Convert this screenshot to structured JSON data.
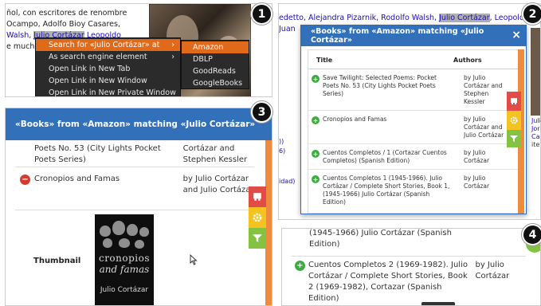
{
  "colors": {
    "popup_header": "#3270ba",
    "menu_highlight": "#e06a1a",
    "remove_icon": "#d63b30",
    "add_icon": "#3dab3d",
    "sidebar_red": "#e04c48",
    "sidebar_yellow": "#f2c321",
    "sidebar_green": "#84c341"
  },
  "step_labels": [
    "1",
    "2",
    "3",
    "4"
  ],
  "panel1": {
    "text_lines": [
      "ñol, con escritores de renombre",
      "Ocampo, Adolfo Bioy Casares,",
      "Walsh,",
      "Julio Cortázar",
      "Leopoldo",
      "e much"
    ],
    "context_menu": [
      {
        "label": "Search for «Julio Cortázar» at",
        "arrow": "›",
        "active": true
      },
      {
        "label": "As search engine element",
        "arrow": "›",
        "active": false
      },
      {
        "label": "Open Link in New Tab",
        "arrow": "",
        "active": false
      },
      {
        "label": "Open Link in New Window",
        "arrow": "",
        "active": false
      },
      {
        "label": "Open Link in New Private Window",
        "arrow": "",
        "active": false
      }
    ],
    "submenu": [
      {
        "label": "Amazon",
        "active": true
      },
      {
        "label": "DBLP",
        "active": false
      },
      {
        "label": "GoodReads",
        "active": false
      },
      {
        "label": "GoogleBooks",
        "active": false
      }
    ]
  },
  "panel2": {
    "bg_line1_prefix": "edetto, Alejandra Pizarnik, Rodolfo Walsh,",
    "bg_line1_highlight": "Julio Cortázar",
    "bg_line1_suffix": ", Leopoldo",
    "bg_line2": "Juan",
    "bg_small": [
      "))",
      "6)",
      "idad)"
    ],
    "right_text": [
      "Julio",
      "Jorg",
      "Cas",
      "ite"
    ],
    "popup_title": "«Books» from «Amazon» matching «Julio Cortázar»",
    "close_label": "×",
    "col_title": "Title",
    "col_authors": "Authors",
    "rows": [
      {
        "icon": "+",
        "title": "Save Twilight: Selected Poems: Pocket Poets No. 53 (City Lights Pocket Poets Series)",
        "authors": "by Julio Cortázar and Stephen Kessler"
      },
      {
        "icon": "+",
        "title": "Cronopios and Famas",
        "authors": "by Julio Cortázar and Julio Cortázar"
      },
      {
        "icon": "+",
        "title": "Cuentos Completos / 1 (Cortazar Cuentos Completos) (Spanish Edition)",
        "authors": "by Julio Cortázar"
      },
      {
        "icon": "+",
        "title": "Cuentos Completos 1 (1945-1966). Julio Cortázar / Complete Short Stories, Book 1, (1945-1966) Julio Cortázar (Spanish Edition)",
        "authors": "by Julio Cortázar"
      }
    ]
  },
  "panel3": {
    "popup_title": "«Books» from «Amazon» matching «Julio Cortázar»",
    "top_row_title": "Poets No. 53 (City Lights Pocket Poets Series)",
    "top_row_authors": "Cortázar and Stephen Kessler",
    "row_icon": "−",
    "row_title": "Cronopios and Famas",
    "row_authors": "by Julio Cortázar and Julio Cortázar",
    "thumbnail_label": "Thumbnail",
    "cover_line1": "cronopios",
    "cover_line2": "and famas",
    "cover_line3": "Julio Cortázar"
  },
  "panel4": {
    "line1": "(1945-1966) Julio Cortázar (Spanish",
    "line2": "Edition)",
    "row_icon": "+",
    "row_title": "Cuentos Completos 2 (1969-1982). Julio Cortázar / Complete Short Stories, Book 2 (1969-1982), Cortazar (Spanish Edition)",
    "row_authors": "by Julio Cortázar"
  }
}
